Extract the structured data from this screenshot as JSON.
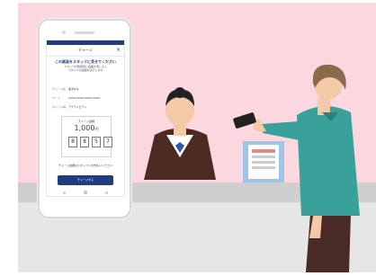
{
  "colors": {
    "background_pink": "#fbd7e0",
    "counter_grey": "#cccccc",
    "phone_bar_navy": "#1f3b82",
    "customer_shirt": "#3aa19a"
  },
  "screen": {
    "header_title": "チャージ",
    "close_icon": "close-icon",
    "question_title": "この画面をスタッフに見せてください",
    "question_note_1": "スタッフが確認後に画面を閉じると",
    "question_note_2": "スタッフの画面を表示します",
    "rows": [
      {
        "label": "チャージ先",
        "value": "楽天Edy"
      },
      {
        "label": "カード",
        "value": "XXXX-XXXX-XXXX-XXXX"
      },
      {
        "label": "ポイント等",
        "value": "アクティビティ"
      }
    ],
    "amount_label": "チャージ金額",
    "amount_value": "1,000",
    "amount_unit": "円",
    "code_digits": [
      "8",
      "8",
      "5",
      "7"
    ],
    "footer_note": "チャージ金額はスタッフにお支払いください",
    "confirm_button": "チャージする"
  }
}
